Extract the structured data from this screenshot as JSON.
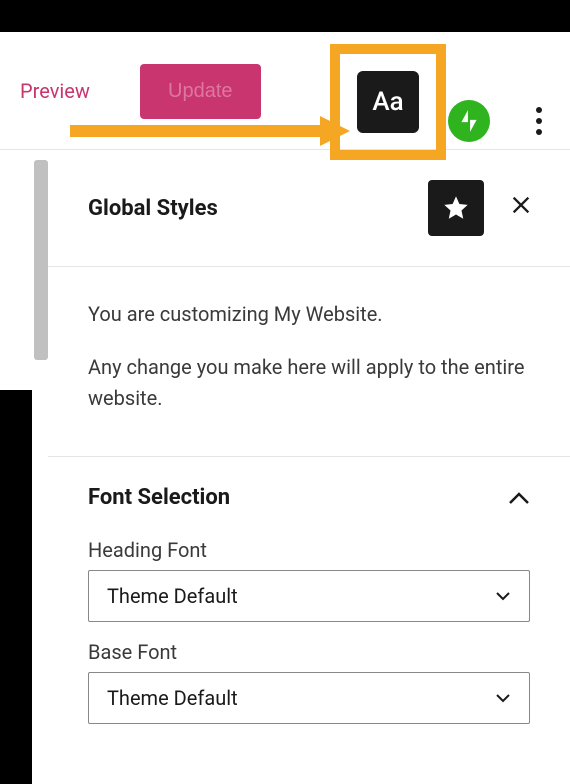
{
  "toolbar": {
    "preview": "Preview",
    "update": "Update",
    "aa_label": "Aa"
  },
  "panel": {
    "title": "Global Styles",
    "intro1": "You are customizing My Website.",
    "intro2": "Any change you make here will apply to the entire website."
  },
  "font_section": {
    "title": "Font Selection",
    "heading_label": "Heading Font",
    "heading_value": "Theme Default",
    "base_label": "Base Font",
    "base_value": "Theme Default"
  }
}
